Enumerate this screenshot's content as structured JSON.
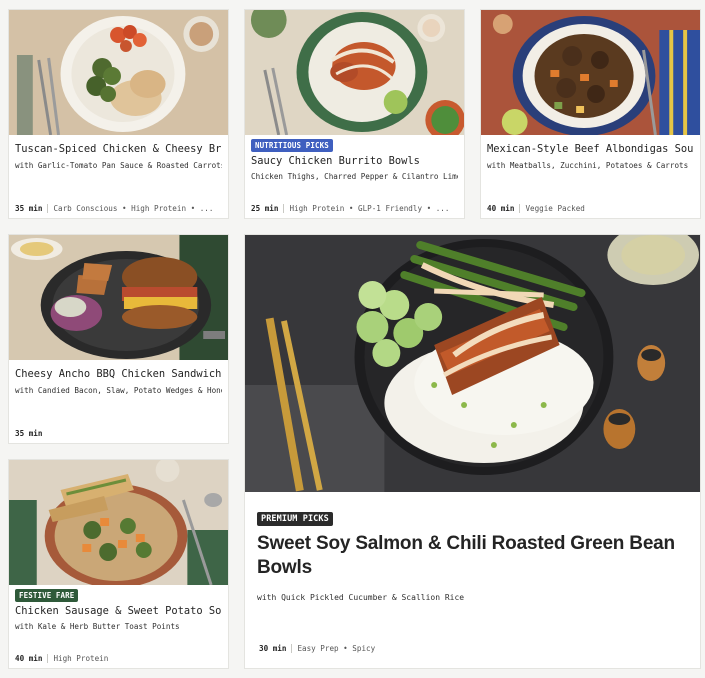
{
  "colors": {
    "nutritious_badge": "#3f5fbf",
    "festive_badge": "#2f5a3a",
    "premium_badge": "#2b2b2b",
    "text": "#242424",
    "card_bg": "#ffffff"
  },
  "cards": [
    {
      "title": "Tuscan-Spiced Chicken & Cheesy Broccoli",
      "subtitle": "with Garlic-Tomato Pan Sauce & Roasted Carrots",
      "time": "35 min",
      "tags": "Carb Conscious • High Protein • ..."
    },
    {
      "badge": "NUTRITIOUS PICKS",
      "title": "Saucy Chicken Burrito Bowls",
      "subtitle": "Chicken Thighs, Charred Pepper & Cilantro Lime Rice",
      "time": "25 min",
      "tags": "High Protein • GLP-1 Friendly • ..."
    },
    {
      "title": "Mexican-Style Beef Albondigas Soup",
      "subtitle": "with Meatballs, Zucchini, Potatoes & Carrots",
      "time": "40 min",
      "tags": "Veggie Packed"
    },
    {
      "title": "Cheesy Ancho BBQ Chicken Sandwiches",
      "subtitle": "with Candied Bacon, Slaw, Potato Wedges & Honey ...",
      "time": "35 min",
      "tags": ""
    },
    {
      "badge": "FESTIVE FARE",
      "title": "Chicken Sausage & Sweet Potato Soup",
      "subtitle": "with Kale & Herb Butter Toast Points",
      "time": "40 min",
      "tags": "High Protein"
    }
  ],
  "featured": {
    "badge": "PREMIUM PICKS",
    "title": "Sweet Soy Salmon & Chili Roasted Green Bean Bowls",
    "subtitle": "with Quick Pickled Cucumber & Scallion Rice",
    "time": "30 min",
    "tags": "Easy Prep • Spicy"
  }
}
